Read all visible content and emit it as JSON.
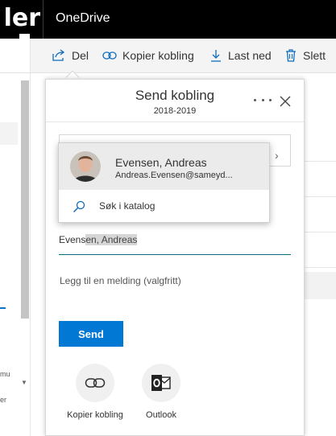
{
  "header": {
    "brand_fragment": "ler",
    "app_title": "OneDrive"
  },
  "left_pane": {
    "fragments": [
      "mu",
      "er"
    ]
  },
  "toolbar": {
    "share_label": "Del",
    "copy_link_label": "Kopier kobling",
    "download_label": "Last ned",
    "delete_label": "Slett"
  },
  "dialog": {
    "title": "Send kobling",
    "subtitle": "2018-2019",
    "suggestion": {
      "name": "Evensen, Andreas",
      "email": "Andreas.Evensen@sameyd..."
    },
    "directory_search_label": "Søk i katalog",
    "recipient": {
      "typed": "Evens",
      "autocomplete": "en, Andreas"
    },
    "message_placeholder": "Legg til en melding (valgfritt)",
    "send_label": "Send",
    "options": [
      {
        "label": "Kopier kobling",
        "icon": "link-icon"
      },
      {
        "label": "Outlook",
        "icon": "outlook-icon"
      }
    ]
  },
  "colors": {
    "accent": "#0078d4",
    "header_bg": "#000000",
    "toolbar_icon": "#0f6cbd"
  }
}
